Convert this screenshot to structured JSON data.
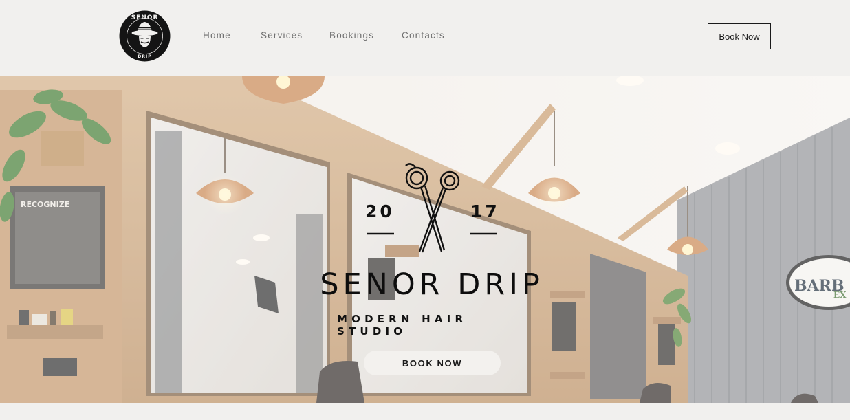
{
  "header": {
    "logo_text_top": "SENOR",
    "logo_text_bottom": "DRIP",
    "nav": [
      {
        "label": "Home"
      },
      {
        "label": "Services"
      },
      {
        "label": "Bookings"
      },
      {
        "label": "Contacts"
      }
    ],
    "book_button": "Book Now"
  },
  "hero": {
    "year_left": "20",
    "year_right": "17",
    "title": "SENOR DRIP",
    "subtitle": "MODERN HAIR STUDIO",
    "cta": "BOOK NOW",
    "sign_text_1": "BARB",
    "sign_text_2": "EX",
    "poster_text": "RECOGNIZE"
  },
  "colors": {
    "background": "#f1f0ee",
    "text_dark": "#111111",
    "nav_text": "#6e6e6e",
    "wood": "#c79a6b"
  }
}
